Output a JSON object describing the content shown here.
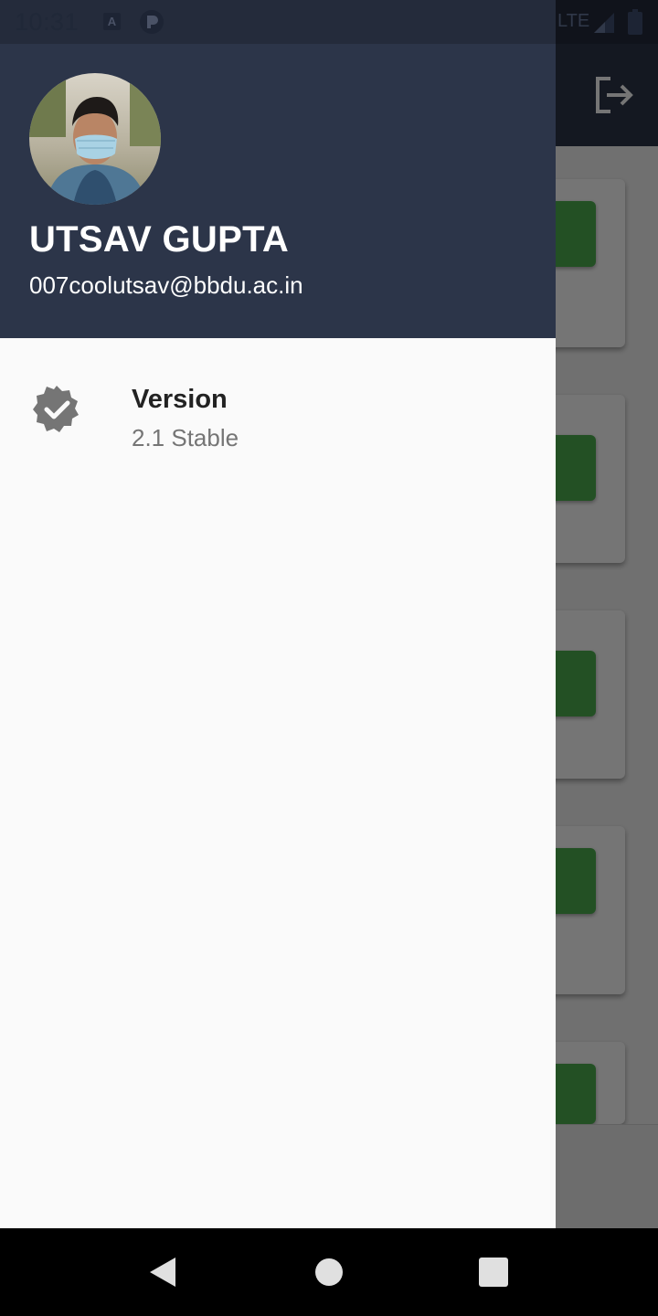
{
  "status_bar": {
    "time": "10:31",
    "notification_icons": [
      "a-icon",
      "p-circle-icon"
    ],
    "network": "LTE",
    "signal_icon": "signal-icon",
    "battery_icon": "battery-icon"
  },
  "app_bar": {
    "action_icon": "logout-icon"
  },
  "drawer": {
    "header": {
      "avatar": "avatar-photo",
      "name": "UTSAV GUPTA",
      "email": "007coolutsav@bbdu.ac.in"
    },
    "items": [
      {
        "icon": "verified-badge-icon",
        "title": "Version",
        "subtitle": "2.1 Stable"
      }
    ]
  },
  "nav_bar": {
    "buttons": [
      "back",
      "home",
      "recents"
    ]
  },
  "colors": {
    "header_bg": "#2c3549",
    "drawer_bg": "#fafafa",
    "card_button_green": "#4caf50",
    "scrim": "rgba(0,0,0,0.54)"
  }
}
